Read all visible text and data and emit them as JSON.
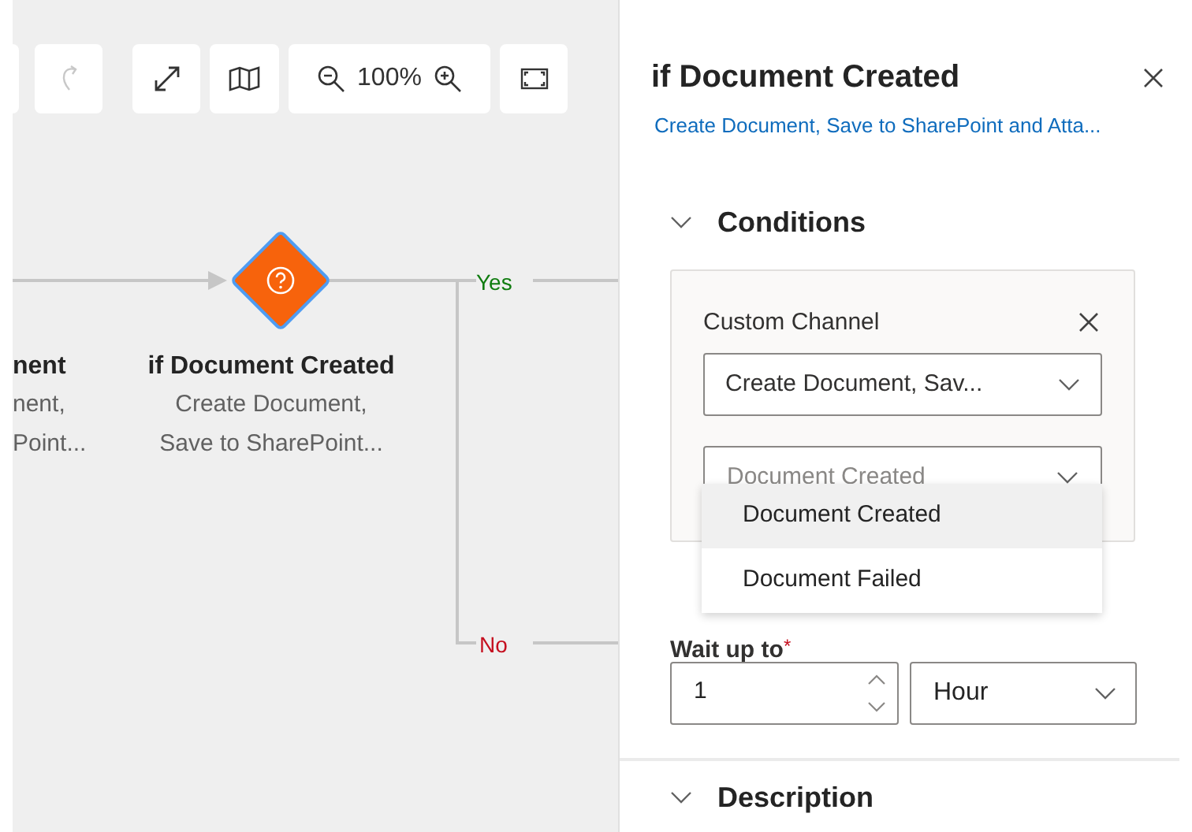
{
  "toolbar": {
    "zoom_level": "100%"
  },
  "canvas": {
    "nodes": [
      {
        "kind": "partial",
        "title": "nent",
        "lines": [
          "nent,",
          "Point..."
        ]
      },
      {
        "kind": "condition",
        "title": "if Document Created",
        "lines": [
          "Create Document,",
          "Save to SharePoint..."
        ]
      }
    ],
    "branches": [
      {
        "label": "Yes",
        "color": "#107c10"
      },
      {
        "label": "No",
        "color": "#c50f1f"
      }
    ]
  },
  "panel": {
    "title": "if Document Created",
    "subtitle": "Create Document, Save to SharePoint and Atta...",
    "sections": [
      {
        "title": "Conditions",
        "expanded": true
      },
      {
        "title": "Description",
        "expanded": true
      }
    ],
    "condition": {
      "label": "Custom Channel",
      "channel_value": "Create Document, Sav...",
      "event_placeholder": "Document Created",
      "options": [
        {
          "label": "Document Created",
          "selected": true
        },
        {
          "label": "Document Failed",
          "selected": false
        }
      ]
    },
    "wait": {
      "label": "Wait up to",
      "required": true,
      "required_mark": "*",
      "value": "1",
      "unit": "Hour"
    }
  }
}
